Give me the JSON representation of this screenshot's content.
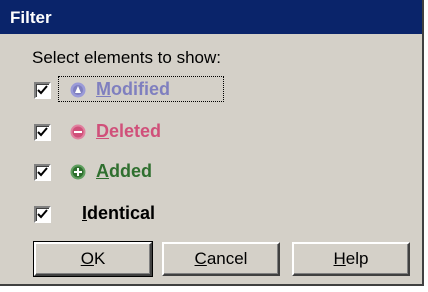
{
  "window": {
    "title": "Filter"
  },
  "prompt": "Select elements to show:",
  "items": [
    {
      "label_accel": "M",
      "label_rest": "odified",
      "checked": true,
      "color": "#7f7fbf",
      "icon": "modified-icon",
      "focused": true
    },
    {
      "label_accel": "D",
      "label_rest": "eleted",
      "checked": true,
      "color": "#d0507a",
      "icon": "deleted-icon",
      "focused": false
    },
    {
      "label_accel": "A",
      "label_rest": "dded",
      "checked": true,
      "color": "#2f6f2f",
      "icon": "added-icon",
      "focused": false
    },
    {
      "label_accel": "I",
      "label_rest": "dentical",
      "checked": true,
      "color": "#000000",
      "icon": "",
      "focused": false
    }
  ],
  "buttons": {
    "ok": {
      "accel": "O",
      "rest": "K"
    },
    "cancel": {
      "accel": "C",
      "rest": "ancel"
    },
    "help": {
      "accel": "H",
      "rest": "elp"
    }
  },
  "colors": {
    "titlebar": "#0a246a",
    "face": "#d4d0c8"
  }
}
